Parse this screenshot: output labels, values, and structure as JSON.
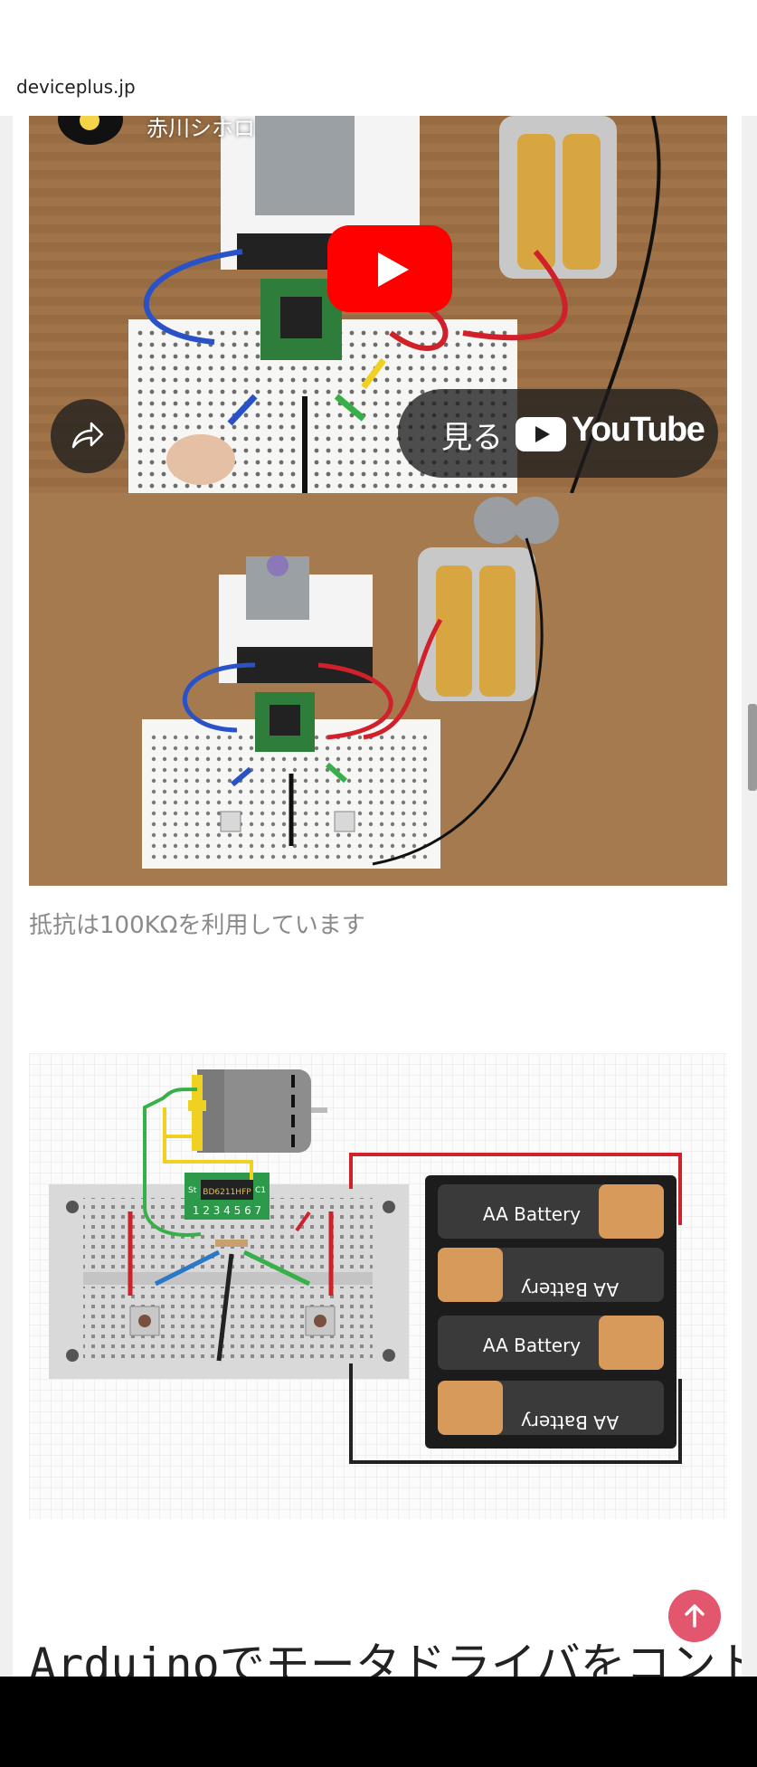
{
  "browser": {
    "url": "deviceplus.jp"
  },
  "video": {
    "channel_name": "赤川シホロ",
    "watch_on": "見る",
    "youtube_wordmark": "YouTube"
  },
  "article": {
    "caption": "抵抗は100KΩを利用しています",
    "heading": "Arduinoでモータドライバをコント"
  },
  "circuit": {
    "ic_label": "BD6211HFP",
    "ic_pins": "1 2 3 4 5 6 7",
    "ic_marks": [
      "St",
      "C1"
    ],
    "batteries": [
      "AA Battery",
      "AA Battery",
      "AA Battery",
      "AA Battery"
    ]
  },
  "colors": {
    "play_red": "#ff0000",
    "back_to_top": "#e2566e",
    "wood": "#a07448",
    "wire_red": "#d0202a",
    "wire_blue": "#2a52c8",
    "wire_green": "#38b04a",
    "wire_yellow": "#f0d020"
  },
  "icons": {
    "play": "play-icon",
    "share": "share-arrow-icon",
    "youtube": "youtube-logo-icon",
    "back_to_top": "arrow-up-icon"
  }
}
